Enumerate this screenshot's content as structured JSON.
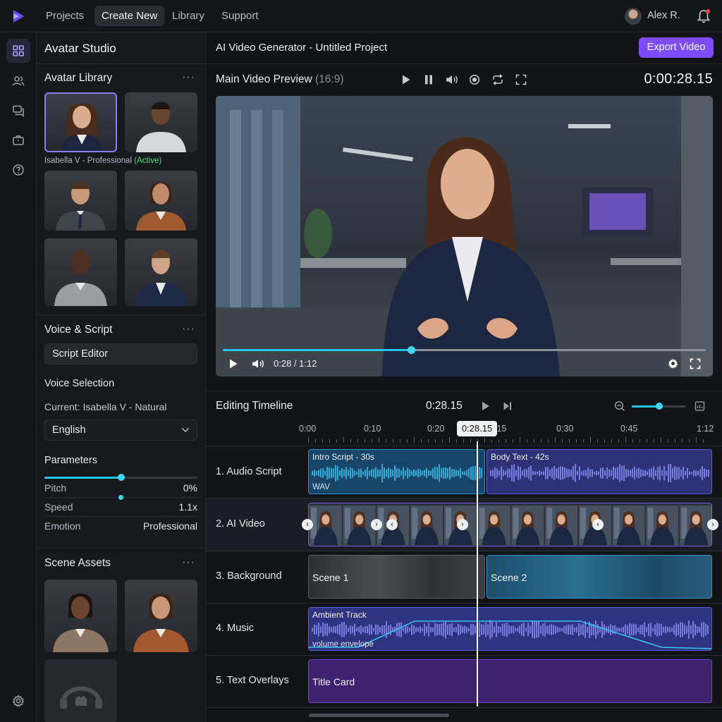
{
  "app": {
    "logo_icon": "play-logo-icon",
    "nav": [
      {
        "label": "Projects"
      },
      {
        "label": "Create New"
      },
      {
        "label": "Library"
      },
      {
        "label": "Support"
      }
    ],
    "active_nav": "Create New",
    "user_name": "Alex R.",
    "accent": "#7c4dff"
  },
  "rail": {
    "icons": [
      "grid-icon",
      "users-icon",
      "chat-icon",
      "briefcase-icon",
      "help-icon",
      "settings-icon"
    ]
  },
  "panel": {
    "title": "Avatar Studio",
    "avatar_library": {
      "title": "Avatar Library",
      "menu": "···",
      "selected_name": "Isabella V - Professional",
      "selected_status": "(Active)"
    },
    "voice": {
      "title": "Voice & Script",
      "menu": "···",
      "script_editor": "Script Editor",
      "selection_title": "Voice Selection",
      "current": "Current: Isabella V - Natural",
      "language": "English"
    },
    "parameters": {
      "title": "Parameters",
      "pitch_label": "Pitch",
      "pitch_value": "0%",
      "pitch_level": 0.5,
      "speed_label": "Speed",
      "speed_value": "1.1x",
      "emotion_label": "Emotion",
      "emotion_value": "Professional"
    },
    "scene_assets": {
      "title": "Scene Assets",
      "menu": "···"
    }
  },
  "main": {
    "project_title": "AI Video Generator - Untitled Project",
    "export_label": "Export Video",
    "preview": {
      "title": "Main Video Preview",
      "ratio": "(16:9)",
      "timecode": "0:00:28.15",
      "player_time": "0:28 / 1:12",
      "progress": 0.39
    },
    "timeline": {
      "title": "Editing Timeline",
      "time": "0:28.15",
      "playhead_label": "0:28.15",
      "zoom_level": 0.5,
      "ruler": [
        "0:00",
        "0:10",
        "0:20",
        "0:30",
        "0:45",
        "1:12"
      ],
      "ruler_partial": ":15",
      "tracks": [
        {
          "label": "1. Audio Script"
        },
        {
          "label": "2. AI Video"
        },
        {
          "label": "3. Background"
        },
        {
          "label": "4. Music"
        },
        {
          "label": "5. Text Overlays"
        }
      ],
      "clips": {
        "intro": "Intro Script - 30s",
        "intro_tag": "WAV",
        "body": "Body Text - 42s",
        "scene1": "Scene 1",
        "scene2": "Scene 2",
        "ambient": "Ambient Track",
        "envelope": "volume envelope",
        "title_card": "Title Card"
      }
    }
  }
}
